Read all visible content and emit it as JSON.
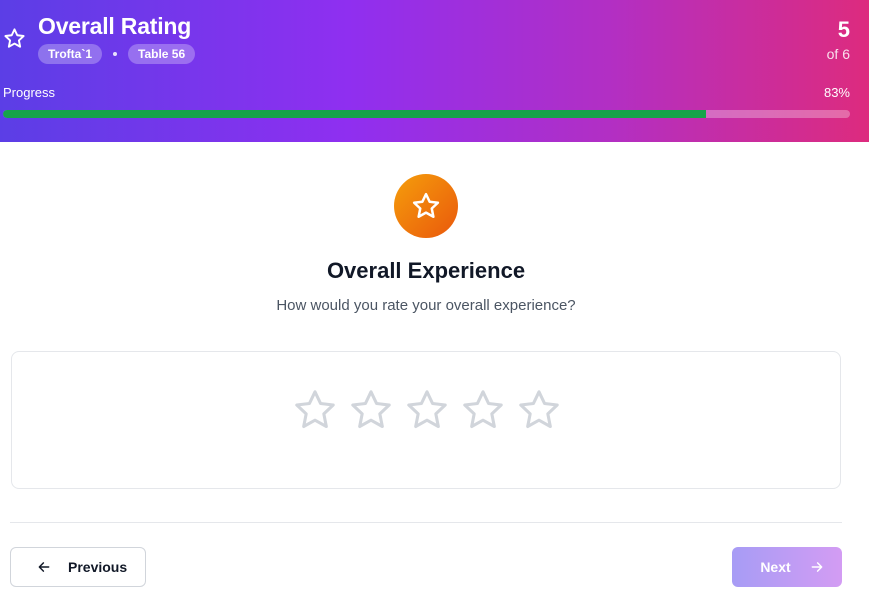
{
  "header": {
    "title": "Overall Rating",
    "chips": [
      "Trofta`1",
      "Table 56"
    ],
    "current": "5",
    "of_label": "of 6",
    "progress_label": "Progress",
    "progress_text": "83%",
    "progress_value": 0.83,
    "icon": "star-outline-icon"
  },
  "question": {
    "icon": "star-outline-icon",
    "title": "Overall Experience",
    "prompt": "How would you rate your overall experience?",
    "rating_max": 5,
    "rating_value": 0
  },
  "nav": {
    "previous_label": "Previous",
    "next_label": "Next",
    "previous_icon": "arrow-left-icon",
    "next_icon": "arrow-right-icon"
  },
  "colors": {
    "header_gradient": [
      "#5b3ee6",
      "#8f2ff0",
      "#dd2b7e"
    ],
    "progress_fill": "#16a34a",
    "badge_gradient": [
      "#f59e0b",
      "#ea580c"
    ],
    "star_empty": "#d1d5db",
    "next_button": "#b89cf4"
  }
}
